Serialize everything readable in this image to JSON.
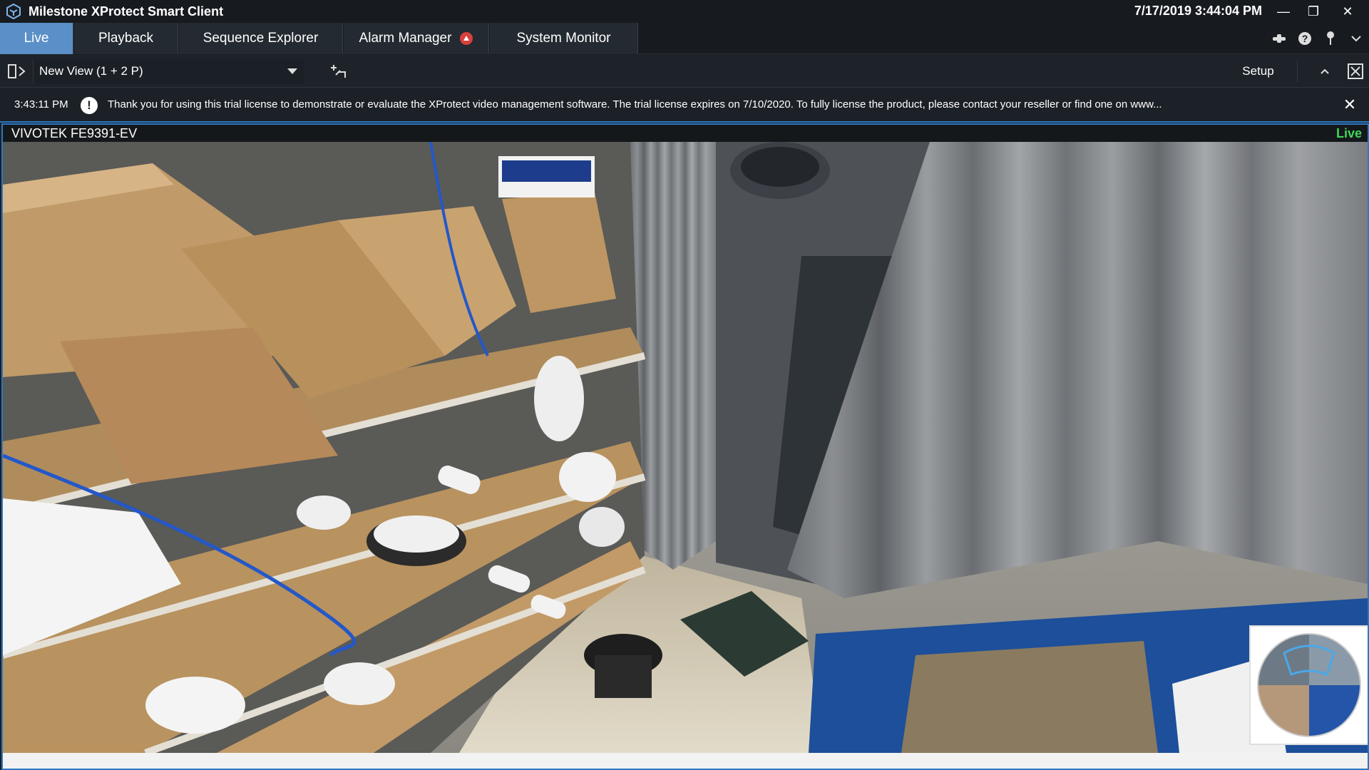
{
  "app": {
    "title": "Milestone XProtect Smart Client",
    "datetime": "7/17/2019 3:44:04 PM"
  },
  "window_controls": {
    "minimize": "—",
    "restore": "❐",
    "close": "✕"
  },
  "tabs": [
    {
      "label": "Live",
      "active": true
    },
    {
      "label": "Playback",
      "active": false
    },
    {
      "label": "Sequence Explorer",
      "active": false
    },
    {
      "label": "Alarm Manager",
      "active": false
    },
    {
      "label": "System Monitor",
      "active": false
    }
  ],
  "toolbar": {
    "view_name": "New View (1 + 2 P)",
    "setup_label": "Setup"
  },
  "notification": {
    "time": "3:43:11 PM",
    "icon": "!",
    "message": "Thank you for using this trial license to demonstrate or evaluate the XProtect video management software. The trial license expires on 7/10/2020. To fully license the product, please contact your reseller or find one on www....",
    "close": "✕"
  },
  "camera": {
    "name": "VIVOTEK FE9391-EV",
    "status": "Live",
    "status_color": "#3fd65a"
  },
  "colors": {
    "accent": "#5a8fc7",
    "highlight_border": "#2b78c2",
    "alarm": "#d8403d"
  }
}
